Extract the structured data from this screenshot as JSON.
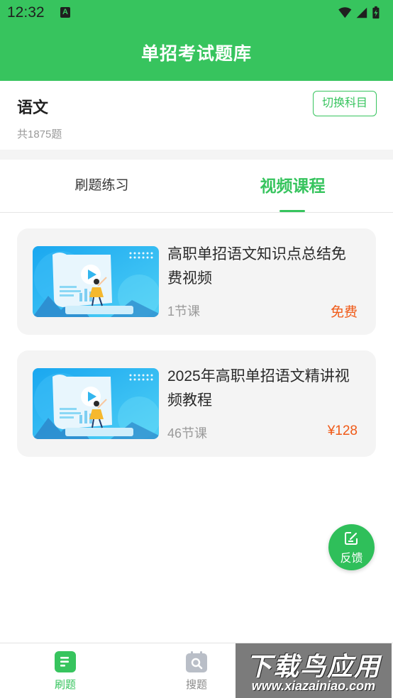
{
  "status_bar": {
    "time": "12:32",
    "notification_letter": "A"
  },
  "header": {
    "title": "单招考试题库",
    "color": "#37c45e"
  },
  "subject": {
    "name": "语文",
    "count": "共1875题",
    "switch_label": "切换科目"
  },
  "tabs": [
    {
      "label": "刷题练习",
      "active": false
    },
    {
      "label": "视频课程",
      "active": true
    }
  ],
  "courses": [
    {
      "title": "高职单招语文知识点总结免费视频",
      "lessons": "1节课",
      "price": "免费"
    },
    {
      "title": "2025年高职单招语文精讲视频教程",
      "lessons": "46节课",
      "price": "¥128"
    }
  ],
  "feedback": {
    "label": "反馈",
    "icon": "edit-icon"
  },
  "bottom_nav": [
    {
      "label": "刷题",
      "icon": "document-icon",
      "active": true
    },
    {
      "label": "搜题",
      "icon": "search-calendar-icon",
      "active": false
    }
  ],
  "watermark": {
    "main": "下载鸟应用",
    "url": "www.xiazainiao.com"
  },
  "colors": {
    "accent": "#37c45e",
    "price": "#f05a17"
  }
}
